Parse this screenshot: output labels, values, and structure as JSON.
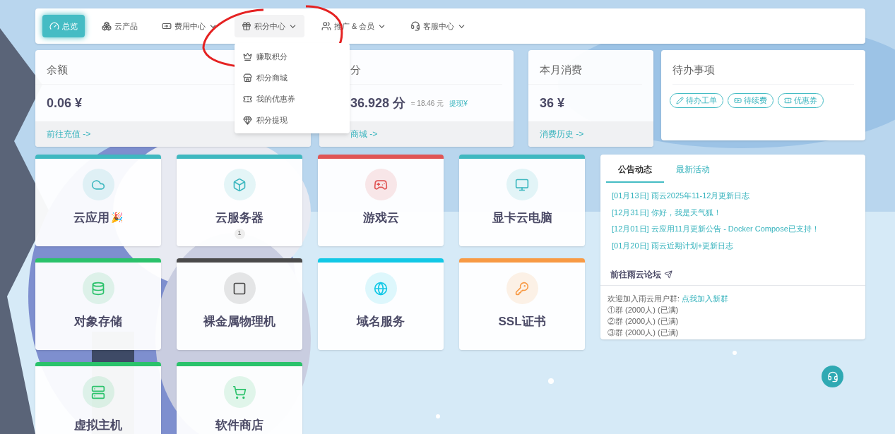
{
  "nav": [
    {
      "label": "总览",
      "selected": true,
      "dropdown": false
    },
    {
      "label": "云产品",
      "selected": false,
      "dropdown": false
    },
    {
      "label": "费用中心",
      "selected": false,
      "dropdown": true
    },
    {
      "label": "积分中心",
      "selected": false,
      "dropdown": true,
      "expanded": true
    },
    {
      "label": "推广 & 会员",
      "selected": false,
      "dropdown": true
    },
    {
      "label": "客服中心",
      "selected": false,
      "dropdown": true
    }
  ],
  "dropdown_menu": [
    "赚取积分",
    "积分商城",
    "我的优惠券",
    "积分提现"
  ],
  "balance": {
    "title": "余额",
    "value": "0.06 ¥",
    "link": "前往充值 ->"
  },
  "points": {
    "title": "分",
    "value": "36.928 分",
    "approx": "≈ 18.46 元",
    "withdraw": "提现¥",
    "link": "商城 ->"
  },
  "monthly": {
    "title": "本月消费",
    "value": "36 ¥",
    "link": "消费历史 ->"
  },
  "todo": {
    "title": "待办事项",
    "buttons": [
      "待办工单",
      "待续费",
      "优惠券"
    ]
  },
  "tiles": [
    {
      "label": "云应用",
      "color": "#3fb8c0",
      "emoji": "🎉"
    },
    {
      "label": "云服务器",
      "color": "#3fb8c0",
      "badge": "1"
    },
    {
      "label": "游戏云",
      "color": "#e05555"
    },
    {
      "label": "显卡云电脑",
      "color": "#3fb8c0"
    },
    {
      "label": "对象存储",
      "color": "#2bc26b"
    },
    {
      "label": "裸金属物理机",
      "color": "#4a4a4a"
    },
    {
      "label": "域名服务",
      "color": "#12c8e6"
    },
    {
      "label": "SSL证书",
      "color": "#f89a44"
    },
    {
      "label": "虚拟主机",
      "color": "#2bc26b"
    },
    {
      "label": "软件商店",
      "color": "#2bc26b"
    }
  ],
  "news": {
    "tabs": [
      {
        "label": "公告动态",
        "selected": true
      },
      {
        "label": "最新活动",
        "selected": false
      }
    ],
    "items": [
      {
        "date": "[01月13日]",
        "title": "雨云2025年11-12月更新日志"
      },
      {
        "date": "[12月31日]",
        "title": "你好，我是天气狐！"
      },
      {
        "date": "[12月01日]",
        "title": "云应用11月更新公告 - Docker Compose已支持！"
      },
      {
        "date": "[01月20日]",
        "title": "雨云近期计划+更新日志"
      }
    ],
    "forum": "前往雨云论坛",
    "group_intro": "欢迎加入雨云用户群: ",
    "group_link": "点我加入新群",
    "groups": [
      "①群 (2000人) (已满)",
      "②群 (2000人) (已满)",
      "③群 (2000人) (已满)"
    ]
  }
}
